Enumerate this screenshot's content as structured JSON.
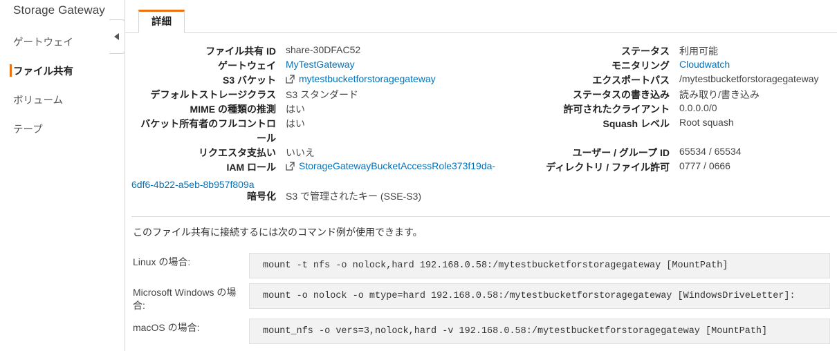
{
  "sidebar": {
    "title": "Storage Gateway",
    "items": [
      {
        "label": "ゲートウェイ"
      },
      {
        "label": "ファイル共有"
      },
      {
        "label": "ボリューム"
      },
      {
        "label": "テープ"
      }
    ]
  },
  "collapse_handle": {
    "icon": "triangle-left-icon"
  },
  "tabs": [
    {
      "label": "詳細"
    }
  ],
  "details_left": [
    {
      "label": "ファイル共有 ID",
      "value": "share-30DFAC52"
    },
    {
      "label": "ゲートウェイ",
      "value": "MyTestGateway"
    },
    {
      "label": "S3 バケット",
      "value": "mytestbucketforstoragegateway"
    },
    {
      "label": "デフォルトストレージクラス",
      "value": "S3 スタンダード"
    },
    {
      "label": "MIME の種類の推測",
      "value": "はい"
    },
    {
      "label": "バケット所有者のフルコントロ",
      "label_line2": "ール",
      "value": "はい"
    },
    {
      "label": "リクエスタ支払い",
      "value": "いいえ"
    },
    {
      "label": "IAM ロール",
      "value": "StorageGatewayBucketAccessRole373f19da-",
      "value_wrap": "6df6-4b22-a5eb-8b957f809a"
    },
    {
      "label": "暗号化",
      "value": "S3 で管理されたキー (SSE-S3)"
    }
  ],
  "details_right": [
    {
      "label": "ステータス",
      "value": "利用可能"
    },
    {
      "label": "モニタリング",
      "value": "Cloudwatch"
    },
    {
      "label": "エクスポートパス",
      "value": "/mytestbucketforstoragegateway"
    },
    {
      "label": "ステータスの書き込み",
      "value": "読み取り/書き込み"
    },
    {
      "label": "許可されたクライアント",
      "value": "0.0.0.0/0"
    },
    {
      "label": "Squash レベル",
      "value": "Root squash"
    },
    {
      "label": "ユーザー / グループ ID",
      "value": "65534 / 65534"
    },
    {
      "label": "ディレクトリ / ファイル許可",
      "value": "0777 / 0666"
    }
  ],
  "commands": {
    "intro": "このファイル共有に接続するには次のコマンド例が使用できます。",
    "rows": [
      {
        "label": "Linux の場合:",
        "command": "mount -t nfs -o nolock,hard 192.168.0.58:/mytestbucketforstoragegateway [MountPath]"
      },
      {
        "label": "Microsoft Windows の場合:",
        "command": "mount -o nolock -o mtype=hard 192.168.0.58:/mytestbucketforstoragegateway [WindowsDriveLetter]:"
      },
      {
        "label": "macOS の場合:",
        "command": "mount_nfs -o vers=3,nolock,hard -v 192.168.0.58:/mytestbucketforstoragegateway [MountPath]"
      }
    ]
  },
  "colors": {
    "accent_orange": "#ec7211",
    "link_blue": "#0073bb",
    "code_bg": "#f2f2f2",
    "border": "#d5d5d5"
  }
}
